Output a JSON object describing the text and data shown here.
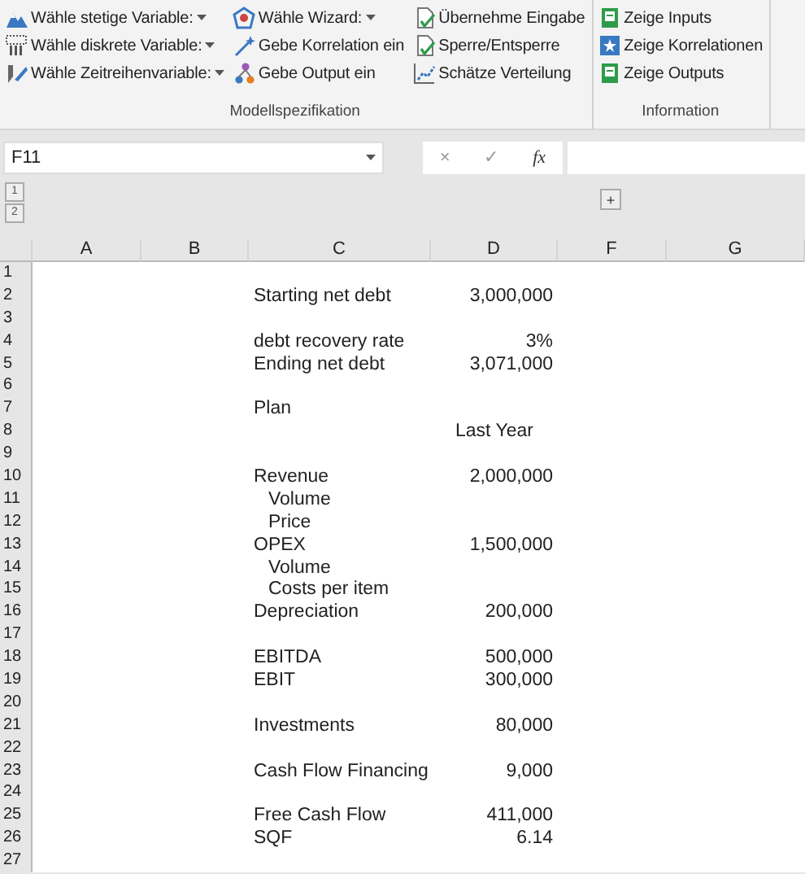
{
  "ribbon": {
    "groups": [
      {
        "label": "Modellspezifikation",
        "columns": [
          [
            {
              "label": "Wähle stetige Variable:",
              "dropdown": true,
              "kind": "mountain"
            },
            {
              "label": "Wähle diskrete Variable:",
              "dropdown": true,
              "kind": "bars"
            },
            {
              "label": "Wähle Zeitreihenvariable:",
              "dropdown": true,
              "kind": "brush"
            }
          ],
          [
            {
              "label": "Wähle Wizard:",
              "dropdown": true,
              "kind": "web"
            },
            {
              "label": "Gebe Korrelation ein",
              "dropdown": false,
              "kind": "wand"
            },
            {
              "label": "Gebe Output ein",
              "dropdown": false,
              "kind": "nodes"
            }
          ],
          [
            {
              "label": "Übernehme Eingabe",
              "dropdown": false,
              "kind": "doc"
            },
            {
              "label": "Sperre/Entsperre",
              "dropdown": false,
              "kind": "doc"
            },
            {
              "label": "Schätze Verteilung",
              "dropdown": false,
              "kind": "chart"
            }
          ]
        ]
      },
      {
        "label": "Information",
        "columns": [
          [
            {
              "label": "Zeige Inputs",
              "dropdown": false,
              "kind": "book"
            },
            {
              "label": "Zeige Korrelationen",
              "dropdown": false,
              "kind": "star"
            },
            {
              "label": "Zeige Outputs",
              "dropdown": false,
              "kind": "book"
            }
          ]
        ]
      }
    ]
  },
  "formula_bar": {
    "name_box": "F11",
    "cancel": "×",
    "enter": "✓",
    "function": "fx"
  },
  "outline": {
    "levels": [
      "1",
      "2"
    ],
    "expand": "+"
  },
  "columns": [
    "A",
    "B",
    "C",
    "D",
    "F",
    "G"
  ],
  "rows": [
    {
      "n": "1"
    },
    {
      "n": "2",
      "c": "Starting net debt",
      "d": "3,000,000"
    },
    {
      "n": "3"
    },
    {
      "n": "4",
      "c": "debt recovery rate",
      "d": "3%"
    },
    {
      "n": "5",
      "c": "Ending net debt",
      "d": "3,071,000"
    },
    {
      "n": "6"
    },
    {
      "n": "7",
      "c": "Plan"
    },
    {
      "n": "8",
      "d": "Last Year",
      "kind": "heading"
    },
    {
      "n": "9"
    },
    {
      "n": "10",
      "c": "Revenue",
      "d": "2,000,000"
    },
    {
      "n": "11",
      "c": "Volume",
      "indented": true
    },
    {
      "n": "12",
      "c": "Price",
      "indented": true
    },
    {
      "n": "13",
      "c": "OPEX",
      "d": "1,500,000"
    },
    {
      "n": "14",
      "c": "Volume",
      "indented": true
    },
    {
      "n": "15",
      "c": "Costs per item",
      "indented": true
    },
    {
      "n": "16",
      "c": "Depreciation",
      "d": "200,000"
    },
    {
      "n": "17"
    },
    {
      "n": "18",
      "c": "EBITDA",
      "d": "500,000"
    },
    {
      "n": "19",
      "c": "EBIT",
      "d": "300,000"
    },
    {
      "n": "20"
    },
    {
      "n": "21",
      "c": "Investments",
      "d": "80,000"
    },
    {
      "n": "22"
    },
    {
      "n": "23",
      "c": "Cash Flow Financing",
      "d": "9,000"
    },
    {
      "n": "24"
    },
    {
      "n": "25",
      "c": "Free Cash Flow",
      "d": "411,000"
    },
    {
      "n": "26",
      "c": "SQF",
      "d": "6.14"
    },
    {
      "n": "27"
    }
  ]
}
